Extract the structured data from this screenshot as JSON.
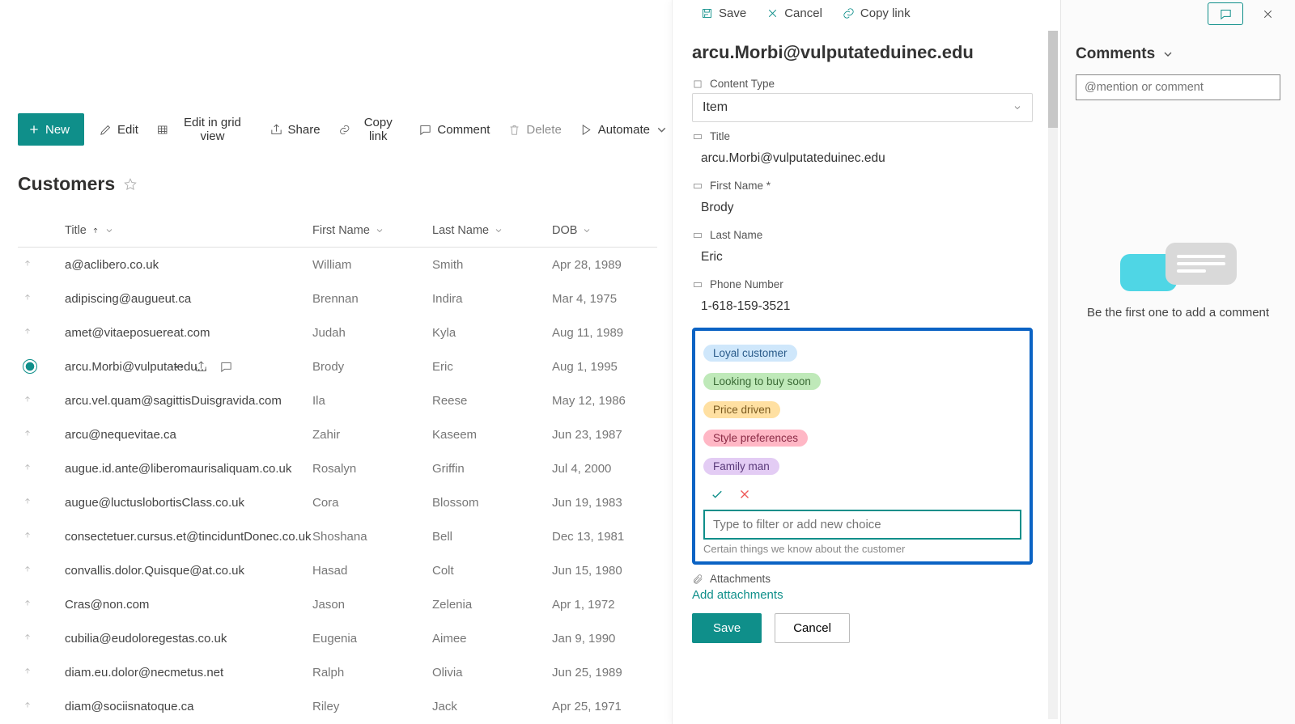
{
  "commands": {
    "new": "New",
    "edit": "Edit",
    "grid": "Edit in grid view",
    "share": "Share",
    "copylink": "Copy link",
    "comment": "Comment",
    "delete": "Delete",
    "automate": "Automate"
  },
  "list": {
    "title": "Customers",
    "columns": {
      "title": "Title",
      "first": "First Name",
      "last": "Last Name",
      "dob": "DOB"
    }
  },
  "rows": [
    {
      "title": "a@aclibero.co.uk",
      "first": "William",
      "last": "Smith",
      "dob": "Apr 28, 1989"
    },
    {
      "title": "adipiscing@augueut.ca",
      "first": "Brennan",
      "last": "Indira",
      "dob": "Mar 4, 1975"
    },
    {
      "title": "amet@vitaeposuereat.com",
      "first": "Judah",
      "last": "Kyla",
      "dob": "Aug 11, 1989"
    },
    {
      "title": "arcu.Morbi@vulputatedu...",
      "first": "Brody",
      "last": "Eric",
      "dob": "Aug 1, 1995",
      "selected": true
    },
    {
      "title": "arcu.vel.quam@sagittisDuisgravida.com",
      "first": "Ila",
      "last": "Reese",
      "dob": "May 12, 1986"
    },
    {
      "title": "arcu@nequevitae.ca",
      "first": "Zahir",
      "last": "Kaseem",
      "dob": "Jun 23, 1987"
    },
    {
      "title": "augue.id.ante@liberomaurisaliquam.co.uk",
      "first": "Rosalyn",
      "last": "Griffin",
      "dob": "Jul 4, 2000"
    },
    {
      "title": "augue@luctuslobortisClass.co.uk",
      "first": "Cora",
      "last": "Blossom",
      "dob": "Jun 19, 1983"
    },
    {
      "title": "consectetuer.cursus.et@tinciduntDonec.co.uk",
      "first": "Shoshana",
      "last": "Bell",
      "dob": "Dec 13, 1981"
    },
    {
      "title": "convallis.dolor.Quisque@at.co.uk",
      "first": "Hasad",
      "last": "Colt",
      "dob": "Jun 15, 1980"
    },
    {
      "title": "Cras@non.com",
      "first": "Jason",
      "last": "Zelenia",
      "dob": "Apr 1, 1972"
    },
    {
      "title": "cubilia@eudoloregestas.co.uk",
      "first": "Eugenia",
      "last": "Aimee",
      "dob": "Jan 9, 1990"
    },
    {
      "title": "diam.eu.dolor@necmetus.net",
      "first": "Ralph",
      "last": "Olivia",
      "dob": "Jun 25, 1989"
    },
    {
      "title": "diam@sociisnatoque.ca",
      "first": "Riley",
      "last": "Jack",
      "dob": "Apr 25, 1971"
    }
  ],
  "panel": {
    "save": "Save",
    "cancel": "Cancel",
    "copylink": "Copy link",
    "heading": "arcu.Morbi@vulputateduinec.edu",
    "content_type_label": "Content Type",
    "content_type_value": "Item",
    "title_label": "Title",
    "title_value": "arcu.Morbi@vulputateduinec.edu",
    "first_label": "First Name *",
    "first_value": "Brody",
    "last_label": "Last Name",
    "last_value": "Eric",
    "phone_label": "Phone Number",
    "phone_value": "1-618-159-3521",
    "choices": [
      {
        "label": "Loyal customer",
        "bg": "#cfe7fb",
        "fg": "#2a5b8a"
      },
      {
        "label": "Looking to buy soon",
        "bg": "#bfe9b9",
        "fg": "#3a6a35"
      },
      {
        "label": "Price driven",
        "bg": "#ffe0a2",
        "fg": "#7a5a1f"
      },
      {
        "label": "Style preferences",
        "bg": "#ffb7c5",
        "fg": "#8a2a45"
      },
      {
        "label": "Family man",
        "bg": "#e3ccf4",
        "fg": "#5a3a7a"
      }
    ],
    "choice_placeholder": "Type to filter or add new choice",
    "helper": "Certain things we know about the customer",
    "attach_label": "Attachments",
    "attach_link": "Add attachments",
    "footer_save": "Save",
    "footer_cancel": "Cancel"
  },
  "comments": {
    "title": "Comments",
    "placeholder": "@mention or comment",
    "empty": "Be the first one to add a comment"
  }
}
